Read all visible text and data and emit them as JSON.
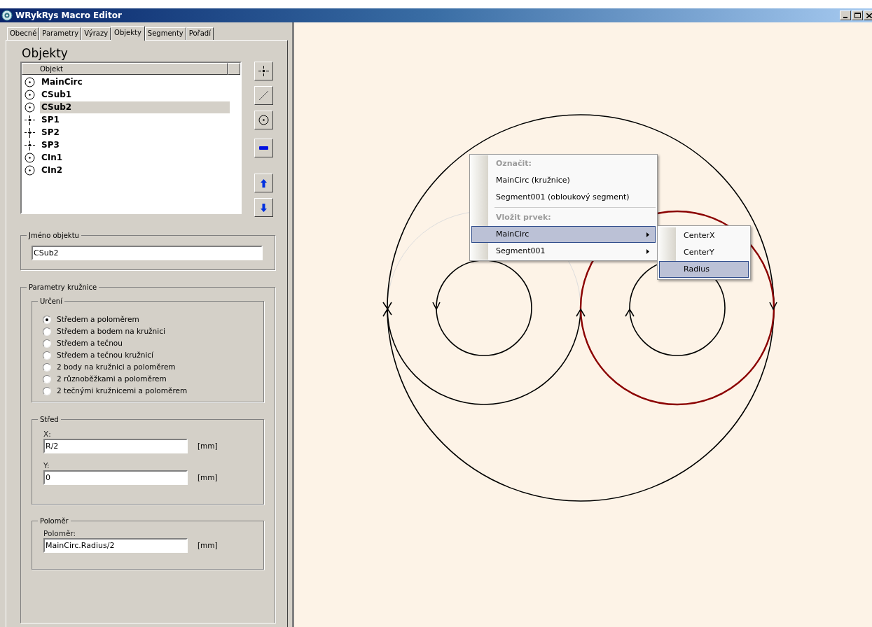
{
  "window": {
    "title": "WRykRys Macro Editor"
  },
  "tabs": [
    {
      "label": "Obecné",
      "selected": false
    },
    {
      "label": "Parametry",
      "selected": false
    },
    {
      "label": "Výrazy",
      "selected": false
    },
    {
      "label": "Objekty",
      "selected": true
    },
    {
      "label": "Segmenty",
      "selected": false
    },
    {
      "label": "Pořadí",
      "selected": false
    }
  ],
  "objects": {
    "heading": "Objekty",
    "column": "Objekt",
    "items": [
      {
        "kind": "circle",
        "label": "MainCirc",
        "selected": false
      },
      {
        "kind": "circle",
        "label": "CSub1",
        "selected": false
      },
      {
        "kind": "circle",
        "label": "CSub2",
        "selected": true
      },
      {
        "kind": "point",
        "label": "SP1",
        "selected": false
      },
      {
        "kind": "point",
        "label": "SP2",
        "selected": false
      },
      {
        "kind": "point",
        "label": "SP3",
        "selected": false
      },
      {
        "kind": "circle",
        "label": "CIn1",
        "selected": false
      },
      {
        "kind": "circle",
        "label": "CIn2",
        "selected": false
      }
    ]
  },
  "object_name": {
    "legend": "Jméno objektu",
    "value": "CSub2"
  },
  "circle_params": {
    "legend": "Parametry kružnice",
    "determination": {
      "legend": "Určení",
      "options": [
        {
          "label": "Středem a poloměrem",
          "selected": true
        },
        {
          "label": "Středem a bodem na kružnici",
          "selected": false
        },
        {
          "label": "Středem a tečnou",
          "selected": false
        },
        {
          "label": "Středem a tečnou kružnicí",
          "selected": false
        },
        {
          "label": "2 body na kružnici a poloměrem",
          "selected": false
        },
        {
          "label": "2 různoběžkami a poloměrem",
          "selected": false
        },
        {
          "label": "2 tečnými kružnicemi a poloměrem",
          "selected": false
        }
      ]
    },
    "center": {
      "legend": "Střed",
      "fields": [
        {
          "label": "X:",
          "value": "R/2",
          "unit": "[mm]"
        },
        {
          "label": "Y:",
          "value": "0",
          "unit": "[mm]"
        }
      ]
    },
    "radius": {
      "legend": "Poloměr",
      "fields": [
        {
          "label": "Poloměr:",
          "value": "MainCirc.Radius/2",
          "unit": "[mm]"
        }
      ]
    }
  },
  "context_menu": {
    "items": [
      {
        "kind": "header",
        "label": "Označit:"
      },
      {
        "kind": "item",
        "label": "MainCirc (kružnice)",
        "selected": false,
        "submenu": false
      },
      {
        "kind": "item",
        "label": "Segment001 (obloukový segment)",
        "selected": false,
        "submenu": false
      },
      {
        "kind": "separator"
      },
      {
        "kind": "header",
        "label": "Vložit prvek:"
      },
      {
        "kind": "item",
        "label": "MainCirc",
        "selected": true,
        "submenu": true
      },
      {
        "kind": "item",
        "label": "Segment001",
        "selected": false,
        "submenu": true
      }
    ],
    "submenu": {
      "items": [
        {
          "label": "CenterX",
          "selected": false
        },
        {
          "label": "CenterY",
          "selected": false
        },
        {
          "label": "Radius",
          "selected": true
        }
      ]
    }
  }
}
